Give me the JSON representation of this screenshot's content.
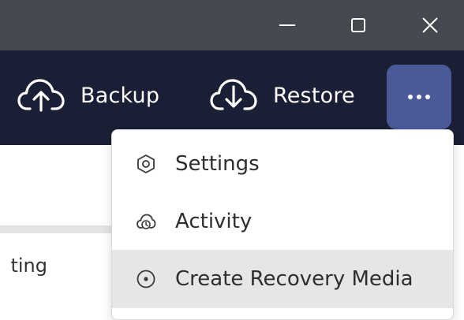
{
  "window": {
    "buttons": [
      {
        "name": "minimize",
        "icon": "minimize-icon"
      },
      {
        "name": "maximize",
        "icon": "maximize-icon"
      },
      {
        "name": "close",
        "icon": "close-icon"
      }
    ]
  },
  "toolbar": {
    "backup_label": "Backup",
    "restore_label": "Restore",
    "backup_icon": "cloud-upload-icon",
    "restore_icon": "cloud-download-icon",
    "more_icon": "more-dots-icon"
  },
  "background": {
    "row_text": "ting"
  },
  "menu": {
    "items": [
      {
        "label": "Settings",
        "icon": "settings-icon"
      },
      {
        "label": "Activity",
        "icon": "activity-icon"
      },
      {
        "label": "Create Recovery Media",
        "icon": "recovery-media-icon"
      }
    ]
  },
  "colors": {
    "titlebar": "#44484f",
    "toolbar": "#1b1f35",
    "accent": "#4a5a98",
    "menu_highlight": "#e6e6e6"
  }
}
